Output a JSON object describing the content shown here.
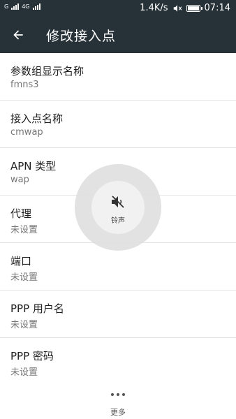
{
  "status_bar": {
    "carrier1": "G",
    "carrier2": "4G",
    "speed": "1.4K/s",
    "time": "07:14"
  },
  "app_bar": {
    "title": "修改接入点"
  },
  "fields": [
    {
      "label": "参数组显示名称",
      "value": "fmns3"
    },
    {
      "label": "接入点名称",
      "value": "cmwap"
    },
    {
      "label": "APN 类型",
      "value": "wap"
    },
    {
      "label": "代理",
      "value": "未设置"
    },
    {
      "label": "端口",
      "value": "未设置"
    },
    {
      "label": "PPP 用户名",
      "value": "未设置"
    },
    {
      "label": "PPP 密码",
      "value": "未设置"
    }
  ],
  "more": {
    "label": "更多"
  },
  "volume_overlay": {
    "label": "铃声",
    "icon": "speaker-muted-icon"
  },
  "colors": {
    "app_bar_bg": "#263238",
    "text_primary": "#212121",
    "text_secondary": "#757575"
  }
}
